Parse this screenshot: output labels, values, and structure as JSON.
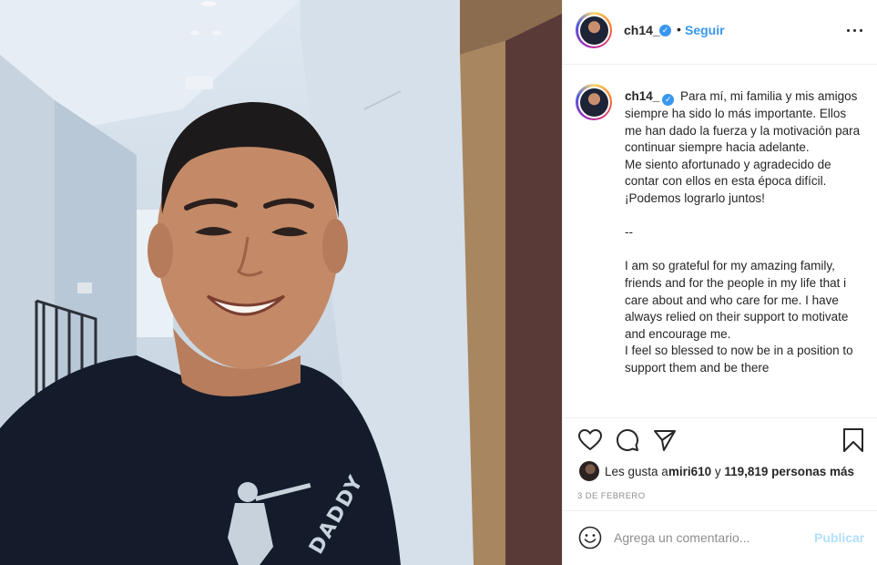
{
  "photo": {
    "shirt_print": "DADDY"
  },
  "header": {
    "username": "ch14_",
    "verified_mark": "✓",
    "separator": "•",
    "follow_label": "Seguir"
  },
  "caption": {
    "username": "ch14_",
    "text": "Para mí, mi familia y mis amigos siempre ha sido lo más importante. Ellos me han dado la fuerza y la motivación para continuar siempre hacia adelante.\nMe siento afortunado y agradecido de contar con ellos en esta época difícil. ¡Podemos lograrlo juntos!\n\n--\n\nI am so grateful for my amazing family, friends and for the people in my life that i care about and who care for me. I have always relied on their support to motivate and encourage me.\nI feel so blessed to now be in a position to support them and be there"
  },
  "likes": {
    "prefix": "Les gusta a ",
    "user": "miri610",
    "joiner": " y ",
    "count": "119,819 personas más"
  },
  "date": "3 DE FEBRERO",
  "comment": {
    "placeholder": "Agrega un comentario...",
    "publish_label": "Publicar"
  },
  "icons": {
    "like": "heart-icon",
    "comment": "comment-icon",
    "share": "paper-plane-icon",
    "save": "bookmark-icon",
    "more": "more-options-icon",
    "emoji": "emoji-icon"
  },
  "colors": {
    "link_blue": "#3897f0",
    "publish_disabled": "#b2dffc",
    "muted_text": "#8e8e8e",
    "border": "#efefef"
  }
}
